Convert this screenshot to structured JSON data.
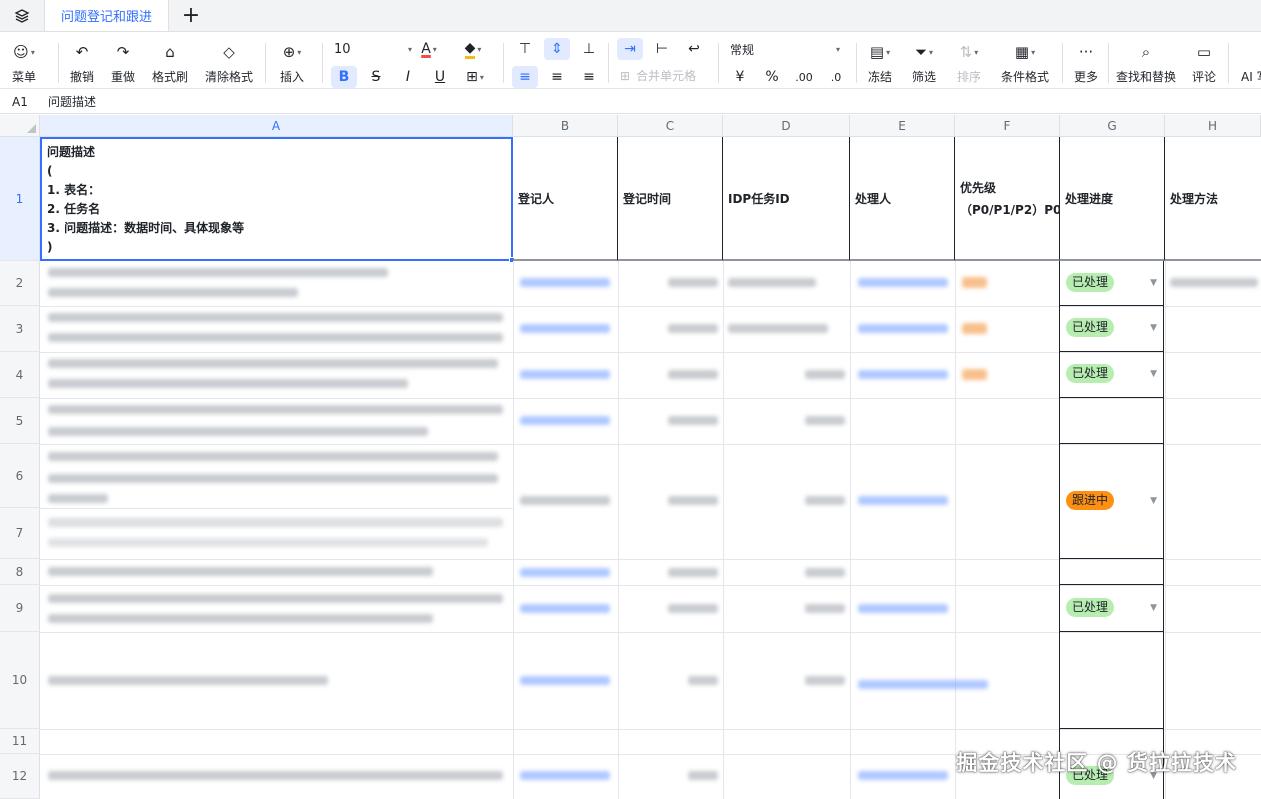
{
  "tabbar": {
    "active_tab": "问题登记和跟进",
    "add_label": "+"
  },
  "toolbar": {
    "menu": "菜单",
    "undo": "撤销",
    "redo": "重做",
    "format_painter": "格式刷",
    "clear_format": "清除格式",
    "insert": "插入",
    "font_size": "10",
    "merge": "合并单元格",
    "number_format": "常规",
    "currency": "¥",
    "percent": "%",
    "dec_add": ".00",
    "dec_remove": ".0",
    "freeze": "冻结",
    "filter": "筛选",
    "sort": "排序",
    "cond_format": "条件格式",
    "more": "更多",
    "find_replace": "查找和替换",
    "comment": "评论",
    "ai": "AI 写"
  },
  "formula_bar": {
    "cell_ref": "A1",
    "value": "问题描述"
  },
  "columns": [
    "A",
    "B",
    "C",
    "D",
    "E",
    "F",
    "G",
    "H"
  ],
  "rows": [
    "1",
    "2",
    "3",
    "4",
    "5",
    "6",
    "7",
    "8",
    "9",
    "10",
    "11",
    "12"
  ],
  "header": {
    "a1": "问题描述\n(\n1. 表名：\n2. 任务名\n3. 问题描述：数据时间、具体现象等\n)",
    "b": "登记人",
    "c": "登记时间",
    "d": "IDP任务ID",
    "e": "处理人",
    "f1": "优先级",
    "f2": "（P0/P1/P2）P0",
    "g": "处理进度",
    "h": "处理方法"
  },
  "status": {
    "r2": "已处理",
    "r3": "已处理",
    "r4": "已处理",
    "r6": "跟进中",
    "r9": "已处理",
    "r12": "已处理"
  },
  "colors": {
    "accent": "#3370ff",
    "done": "#b7edb1",
    "progress": "#fd8f12"
  },
  "watermark": "掘金技术社区 @ 货拉拉技术"
}
